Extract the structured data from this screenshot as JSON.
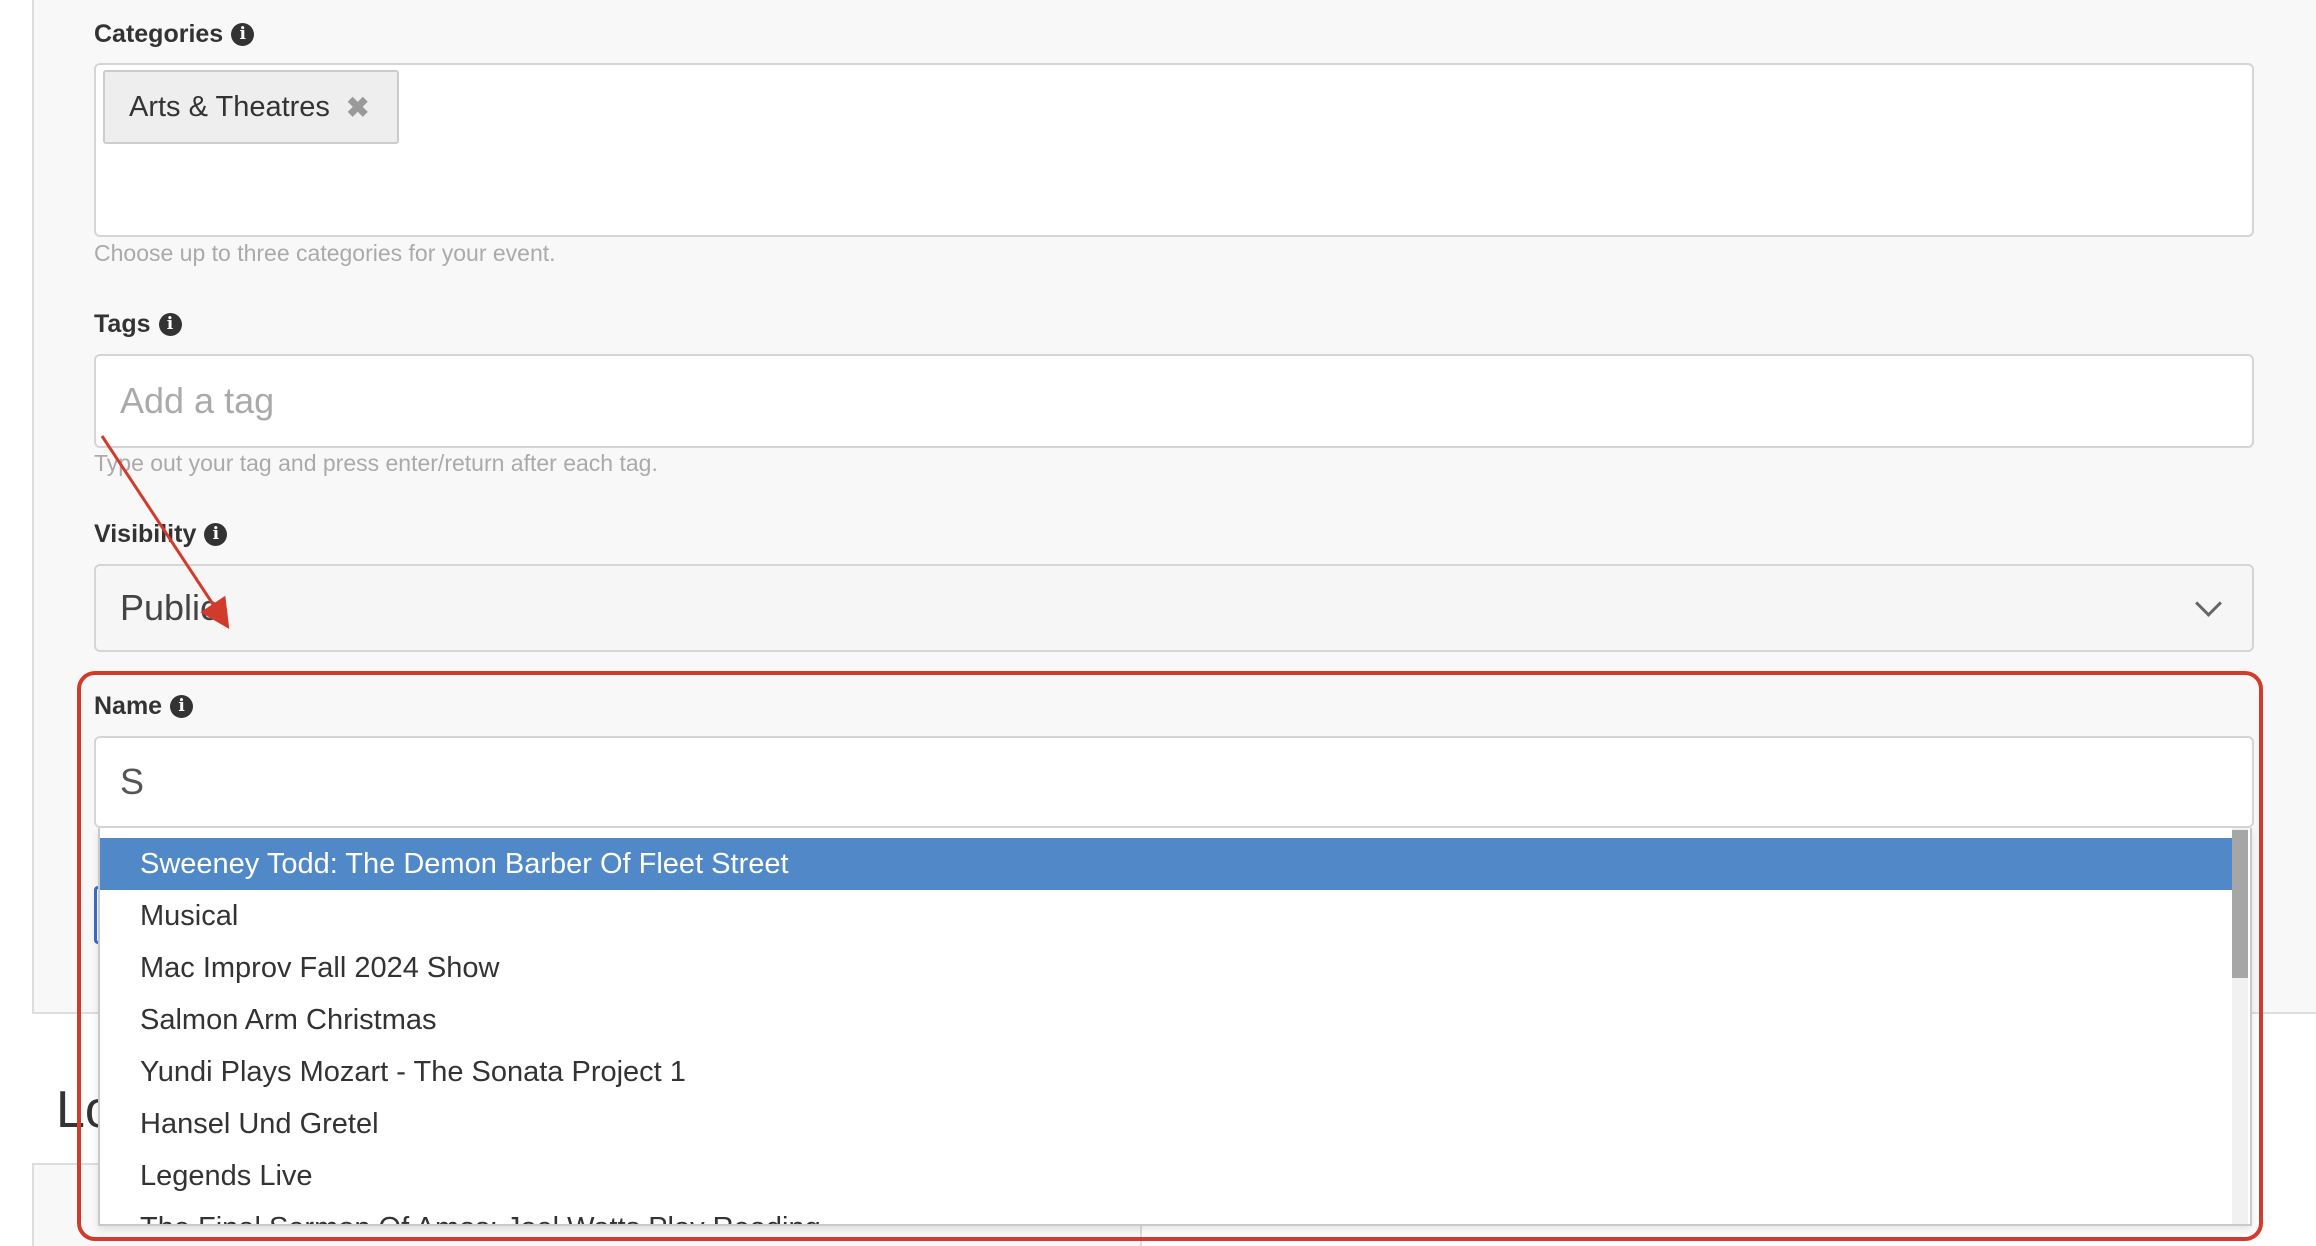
{
  "colors": {
    "accent_highlight": "#d23b2b",
    "selected_item": "#5088c8",
    "panel_bg": "#f8f8f8"
  },
  "categories": {
    "label": "Categories",
    "chips": [
      "Arts & Theatres"
    ],
    "help": "Choose up to three categories for your event."
  },
  "tags": {
    "label": "Tags",
    "placeholder": "Add a tag",
    "help": "Type out your tag and press enter/return after each tag."
  },
  "visibility": {
    "label": "Visibility",
    "value": "Public"
  },
  "name": {
    "label": "Name",
    "value": "S",
    "suggestions": [
      "Sweeney Todd: The Demon Barber Of Fleet Street",
      "Musical",
      "Mac Improv Fall 2024 Show",
      "Salmon Arm Christmas",
      "Yundi Plays Mozart - The Sonata Project 1",
      "Hansel Und Gretel",
      "Legends Live",
      "The Final Sermon Of Amos: Joel Watts Play Reading"
    ],
    "selected_index": 0
  },
  "location": {
    "heading": "Location"
  }
}
